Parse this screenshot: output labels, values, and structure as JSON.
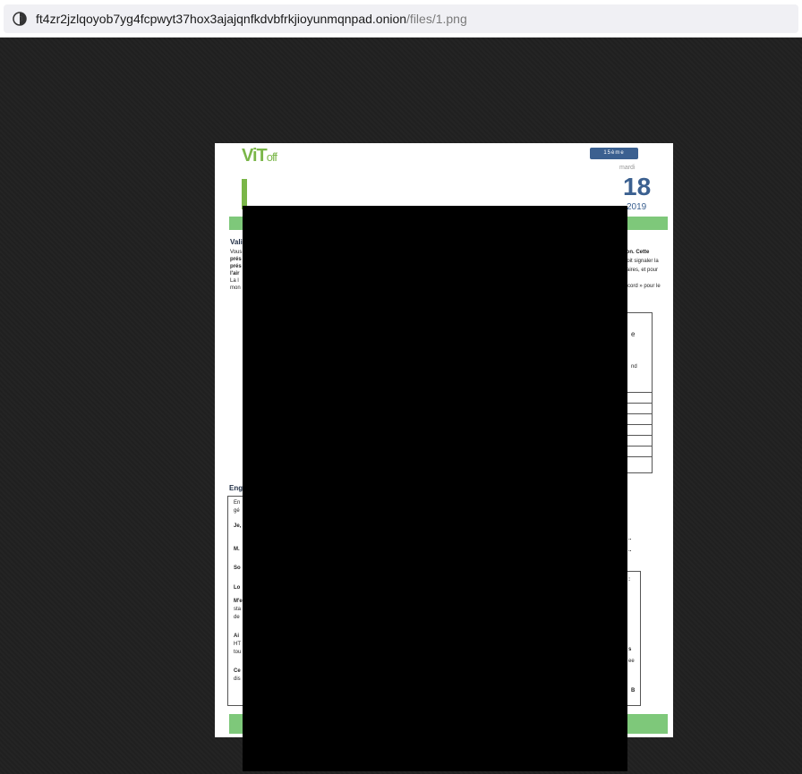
{
  "browser": {
    "url_host": "ft4zr2jzlqoyob7yg4fcpwyt37hox3ajajqnfkdvbfrkjioyunmqnpad.onion",
    "url_path": "/files/1.png"
  },
  "document": {
    "logo_text": "ViT",
    "logo_suffix": "off",
    "edition_badge": "15ème ÉDITION",
    "edition_subtext": "mardi",
    "year_big": "18",
    "year_small": "2019",
    "left_fragments": [
      "Vali",
      "Vous",
      "prés",
      "prés",
      "l'air",
      "La l",
      "mon"
    ],
    "right_fragments": [
      "lisation. Cette",
      "doit signaler la",
      "itaires, et pour",
      "ccord » pour le"
    ],
    "box_right_fragments": [
      "e",
      "nd"
    ],
    "section_engage": "Eng",
    "engage_left": [
      "En",
      "gé",
      "Je,",
      "M.",
      "So",
      "Lo",
      "M'e",
      "sta",
      "de",
      "Ai",
      "HT",
      "tou",
      "Ce",
      "dis"
    ],
    "engage_right": [
      "..",
      "..",
      ":",
      "s",
      "ee",
      "B"
    ]
  },
  "colors": {
    "accent_green": "#7ec87a",
    "logo_green": "#7ab648",
    "brand_blue": "#3b6090",
    "redaction": "#000000"
  }
}
